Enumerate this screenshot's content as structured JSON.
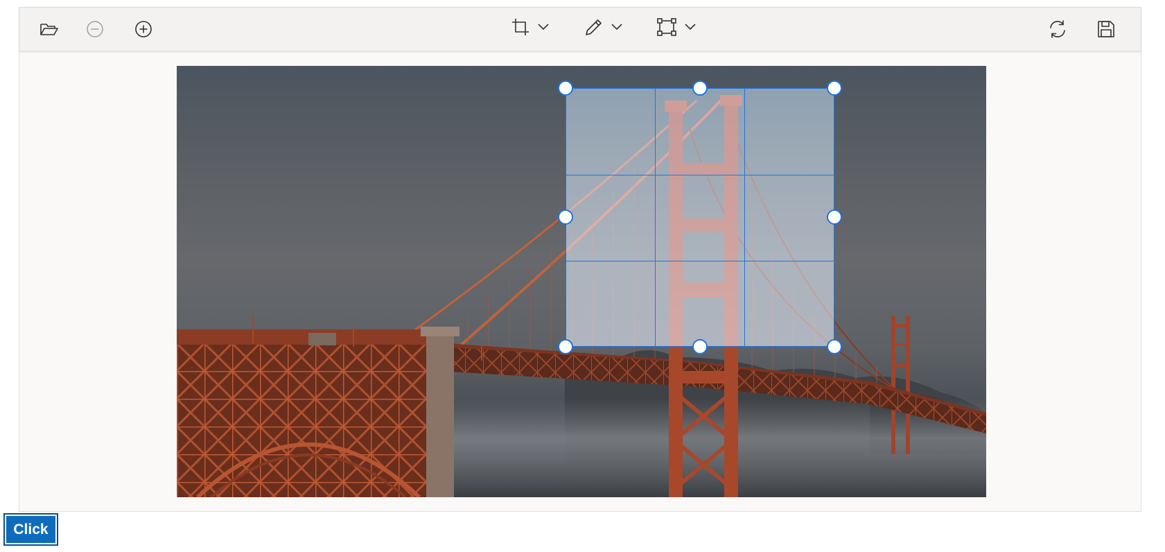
{
  "toolbar": {
    "icons": {
      "open": "folder-open-icon",
      "zoom_out": "zoom-out-icon",
      "zoom_in": "zoom-in-icon",
      "crop": "crop-icon",
      "annotate": "pencil-icon",
      "transform": "transform-icon",
      "reset": "reset-icon",
      "save": "save-icon"
    },
    "zoom_out_disabled": true
  },
  "crop_selection": {
    "handles": [
      "top-left",
      "top-center",
      "top-right",
      "middle-left",
      "middle-right",
      "bottom-left",
      "bottom-center",
      "bottom-right"
    ],
    "grid": "3x3"
  },
  "colors": {
    "accent": "#1f74e0",
    "toolbar_bg": "#f3f2f1",
    "button_bg": "#0f6cbd",
    "bridge": "#a0442a"
  },
  "click_button": {
    "label": "Click"
  }
}
